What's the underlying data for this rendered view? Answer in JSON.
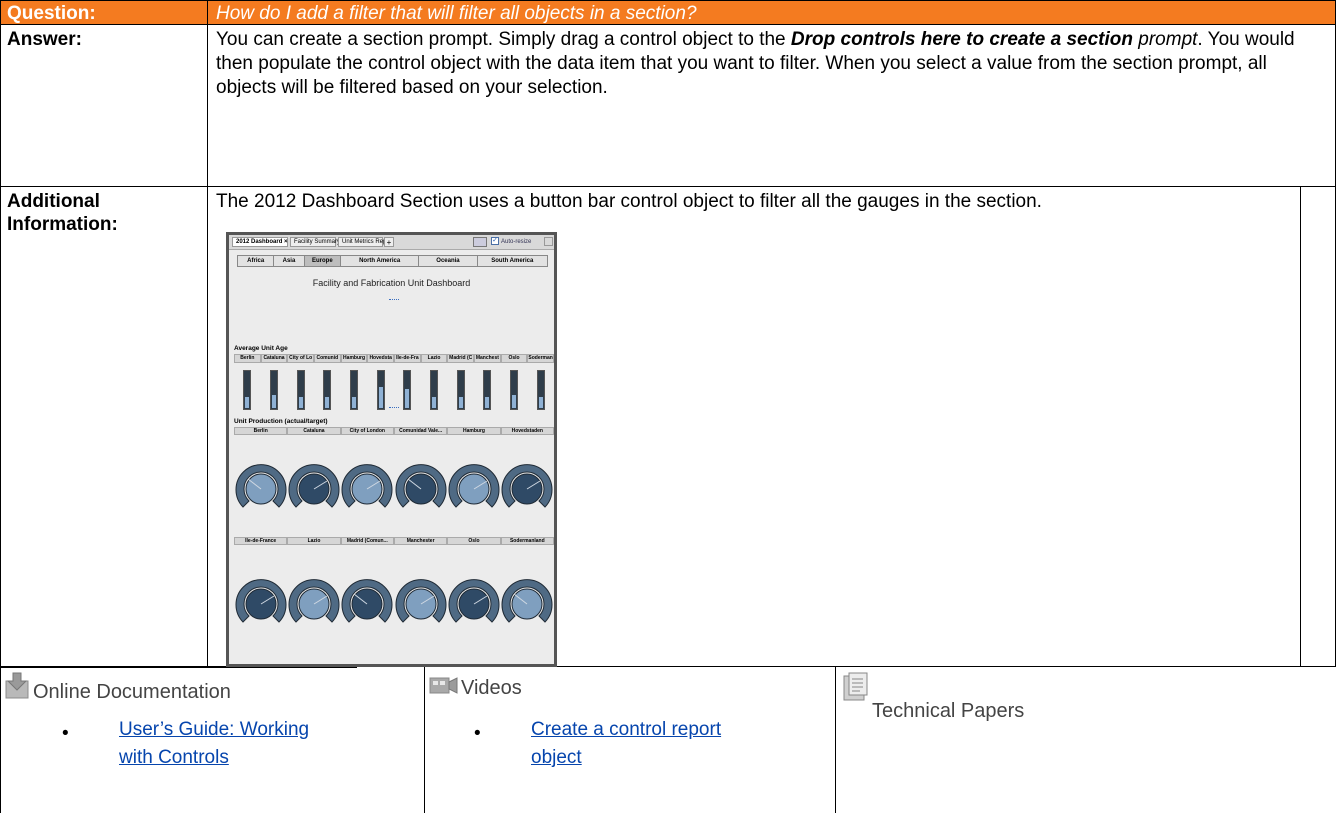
{
  "question": {
    "label": "Question:",
    "text": "How do I add a filter that will filter all objects in a section?"
  },
  "answer": {
    "label": "Answer:",
    "part1": "You can create a section prompt. Simply drag a control object to the ",
    "emph": "Drop controls here to create a section",
    "part2": " prompt",
    "part3": ". You would then populate the control object with the data item that you want to filter. When you select a value from the section prompt, all objects will be filtered based on your selection."
  },
  "additional": {
    "label_line1": "Additional",
    "label_line2": "Information:",
    "text": "The 2012 Dashboard Section uses a button bar control object to filter all the gauges in the section."
  },
  "dashboard": {
    "tabs": [
      {
        "label": "2012 Dashboard ×",
        "active": true
      },
      {
        "label": "Facility Summary",
        "active": false
      },
      {
        "label": "Unit Metrics Report",
        "active": false
      }
    ],
    "auto_resize_label": "Auto-resize",
    "regions": [
      {
        "label": "Africa",
        "selected": false
      },
      {
        "label": "Asia",
        "selected": false
      },
      {
        "label": "Europe",
        "selected": true
      },
      {
        "label": "North America",
        "selected": false
      },
      {
        "label": "Oceania",
        "selected": false
      },
      {
        "label": "South America",
        "selected": false
      }
    ],
    "title": "Facility and Fabrication Unit Dashboard",
    "age_section": "Average Unit Age",
    "age_cities": [
      "Berlin",
      "Cataluna",
      "City of Lo",
      "Comunid",
      "Hamburg",
      "Hovedsta",
      "Ile-de-Fra",
      "Lazio",
      "Madrid (C",
      "Manchest",
      "Oslo",
      "Sodermanl"
    ],
    "age_levels": [
      0.3,
      0.35,
      0.3,
      0.3,
      0.3,
      0.55,
      0.5,
      0.3,
      0.3,
      0.3,
      0.35,
      0.3
    ],
    "prod_section": "Unit Production (actual/target)",
    "prod_row1": [
      "Berlin",
      "Cataluna",
      "City of London",
      "Comunidad Vale...",
      "Hamburg",
      "Hovedstaden"
    ],
    "prod_row2": [
      "Ile-de-France",
      "Lazio",
      "Madrid (Comun...",
      "Manchester",
      "Oslo",
      "Sodermanland"
    ]
  },
  "resources": {
    "online_doc": {
      "heading": "Online Documentation",
      "link_line1": "User’s Guide: Working",
      "link_line2": "with Controls"
    },
    "videos": {
      "heading": "Videos",
      "link_line1": "Create a control report",
      "link_line2": "object"
    },
    "papers": {
      "heading": "Technical Papers"
    }
  }
}
